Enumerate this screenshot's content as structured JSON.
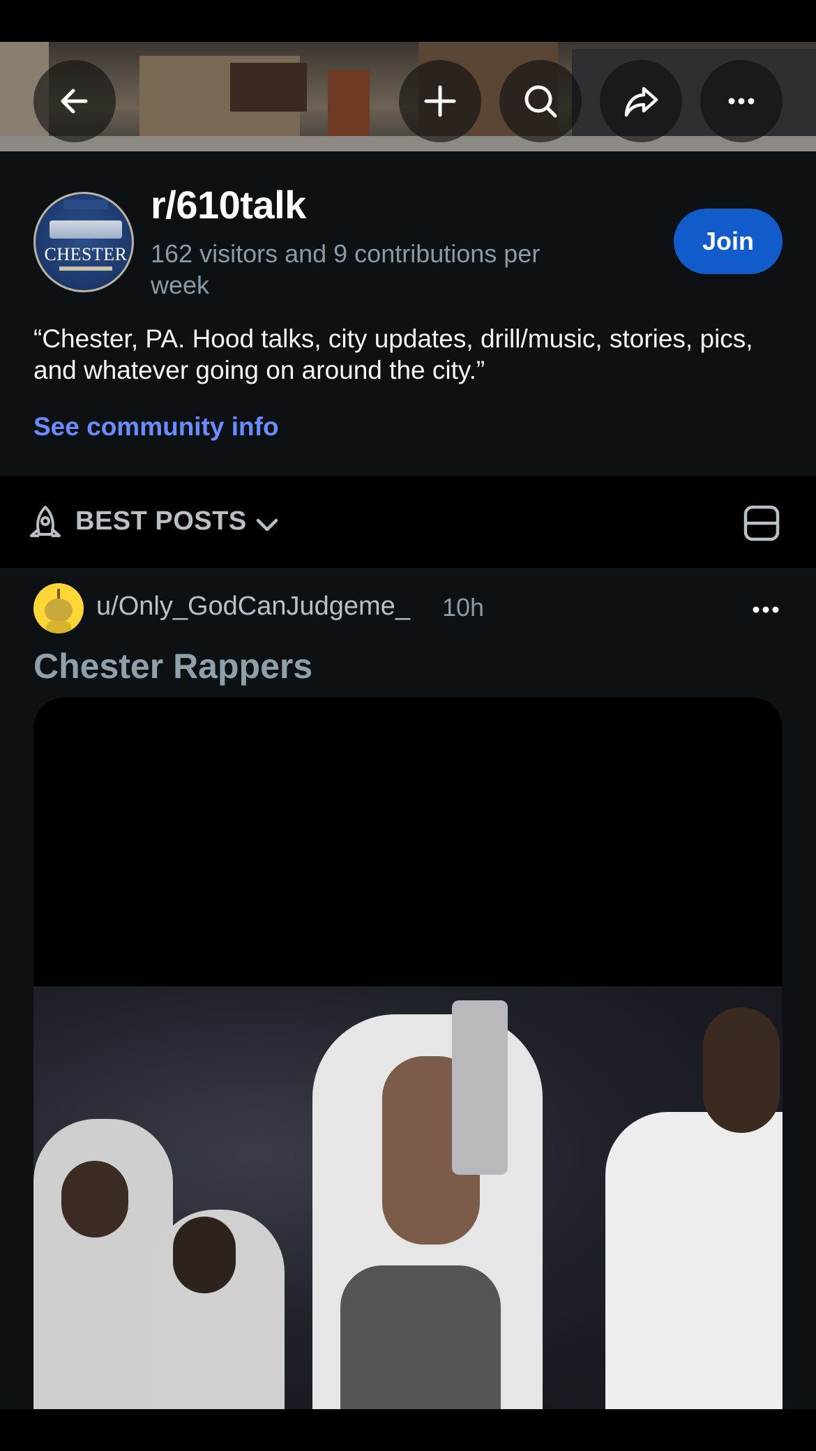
{
  "subreddit": {
    "name": "r/610talk",
    "stats": "162 visitors and 9 contributions per week",
    "description": "“Chester, PA. Hood talks, city updates, drill/music, stories, pics, and whatever going on around the city.”",
    "community_info_link": "See community info",
    "join_label": "Join",
    "avatar_text": "CHESTER"
  },
  "topbar": {
    "icons": [
      "back-arrow-icon",
      "plus-icon",
      "search-icon",
      "share-icon",
      "more-horizontal-icon"
    ]
  },
  "sort": {
    "label": "BEST POSTS",
    "icon": "rocket-icon",
    "view_icon": "card-view-icon"
  },
  "post": {
    "username": "u/Only_GodCanJudgeme_",
    "time": "10h",
    "title": "Chester Rappers"
  },
  "colors": {
    "background": "#0e1113",
    "join_button": "#115bca",
    "link": "#6a8cff",
    "muted_text": "#8a9aa6"
  }
}
